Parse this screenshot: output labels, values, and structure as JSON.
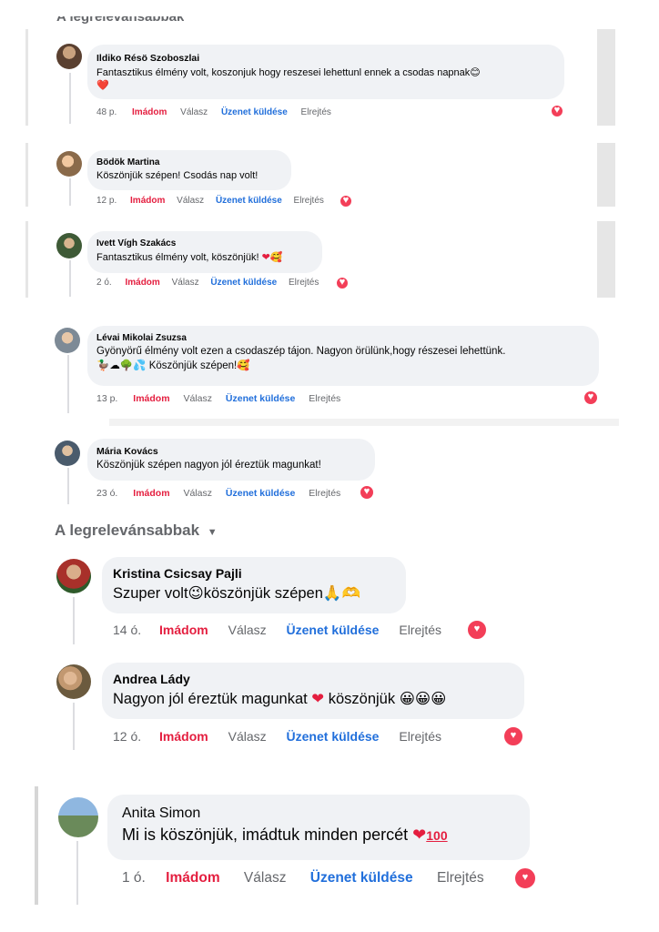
{
  "section_header": {
    "label": "A legrelevánsabbak",
    "partial_label": "A legrelevánsabbak"
  },
  "comments": [
    {
      "author": "Ildiko Résö Szoboszlai",
      "text": "Fantasztikus élmény volt, koszonjuk hogy reszesei lehettunl ennek a csodas napnak",
      "emoji_line": "❤️",
      "time": "48 p.",
      "like": "Imádom",
      "reply": "Válasz",
      "message": "Üzenet küldése",
      "hide": "Elrejtés",
      "reaction": "love-icon"
    },
    {
      "author": "Bödök Martina",
      "text": "Köszönjük szépen! Csodás nap volt!",
      "time": "12 p.",
      "like": "Imádom",
      "reply": "Válasz",
      "message": "Üzenet küldése",
      "hide": "Elrejtés",
      "reaction": "love-icon"
    },
    {
      "author": "Ivett Vígh Szakács",
      "text": "Fantasztikus élmény volt, köszönjük!",
      "time": "2 ó.",
      "like": "Imádom",
      "reply": "Válasz",
      "message": "Üzenet küldése",
      "hide": "Elrejtés",
      "reaction": "love-icon"
    },
    {
      "author": "Lévai Mikolai Zsuzsa",
      "text": "Gyönyörű élmény volt ezen a csodaszép tájon. Nagyon örülünk,hogy részesei lehettünk.",
      "text2": "Köszönjük szépen!",
      "time": "13 p.",
      "like": "Imádom",
      "reply": "Válasz",
      "message": "Üzenet küldése",
      "hide": "Elrejtés",
      "reaction": "love-icon"
    },
    {
      "author": "Mária Kovács",
      "text": "Köszönjük szépen nagyon jól éreztük magunkat!",
      "time": "23 ó.",
      "like": "Imádom",
      "reply": "Válasz",
      "message": "Üzenet küldése",
      "hide": "Elrejtés",
      "reaction": "love-icon"
    },
    {
      "author": "Kristina Csicsay Pajli",
      "text_a": "Szuper volt",
      "text_b": "köszönjük szépen",
      "time": "14 ó.",
      "like": "Imádom",
      "reply": "Válasz",
      "message": "Üzenet küldése",
      "hide": "Elrejtés",
      "reaction": "love-icon"
    },
    {
      "author": "Andrea Lády",
      "text_a": "Nagyon jól éreztük magunkat",
      "text_b": "köszönjük",
      "time": "12 ó.",
      "like": "Imádom",
      "reply": "Válasz",
      "message": "Üzenet küldése",
      "hide": "Elrejtés",
      "reaction": "love-icon"
    },
    {
      "author": "Anita Simon",
      "text": "Mi is köszönjük, imádtuk minden percét",
      "time": "1 ó.",
      "like": "Imádom",
      "reply": "Válasz",
      "message": "Üzenet küldése",
      "hide": "Elrejtés",
      "reaction": "love-icon"
    }
  ],
  "colors": {
    "like": "#e41e3f",
    "message": "#216fdb",
    "muted": "#65676b",
    "bubble": "#f0f2f5",
    "reaction": "#f33e58"
  }
}
